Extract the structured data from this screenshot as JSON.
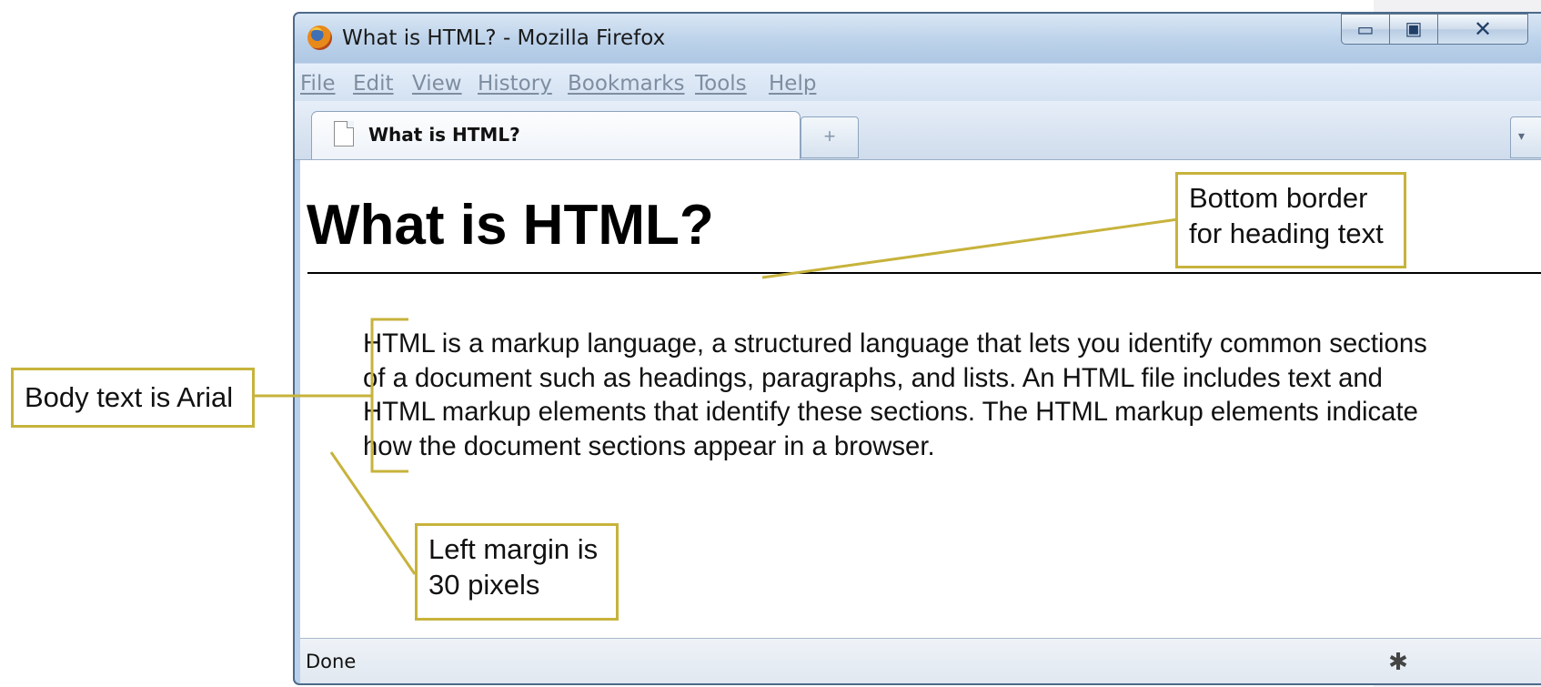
{
  "window": {
    "title": "What is HTML? - Mozilla Firefox",
    "minimize_glyph": "▭",
    "maximize_glyph": "▣",
    "close_glyph": "✕"
  },
  "menu": [
    "File",
    "Edit",
    "View",
    "History",
    "Bookmarks",
    "Tools",
    "Help"
  ],
  "tab": {
    "label": "What is HTML?",
    "new_tab_glyph": "+",
    "list_glyph": "▾"
  },
  "page": {
    "heading": "What is HTML?",
    "paragraph": "HTML is a markup language, a structured language that lets you identify common sections of a document such as headings, paragraphs, and lists. An HTML file includes text and HTML markup elements that identify these sections. The HTML markup elements indicate how the document sections appear in a browser."
  },
  "status": {
    "text": "Done",
    "icon": "bug-icon"
  },
  "callouts": {
    "bottom_border": "Bottom border\nfor heading text",
    "body_text": "Body text is Arial",
    "left_margin": "Left margin is\n30 pixels"
  },
  "colors": {
    "callout_border": "#c7b33c",
    "window_frame": "#b9d1ea"
  }
}
